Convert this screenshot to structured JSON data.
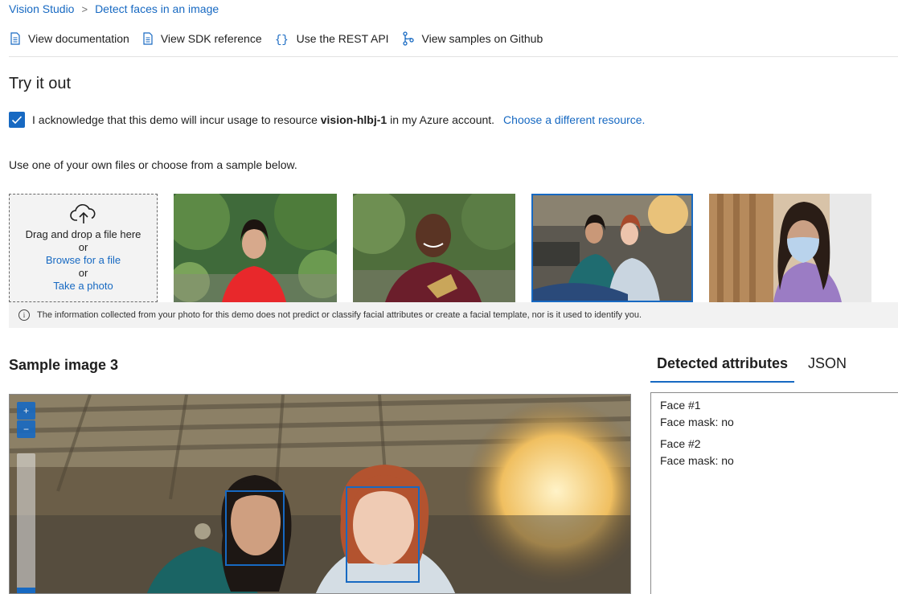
{
  "breadcrumb": {
    "root": "Vision Studio",
    "current": "Detect faces in an image"
  },
  "toolbar": {
    "docs": "View documentation",
    "sdk": "View SDK reference",
    "rest": "Use the REST API",
    "github": "View samples on Github"
  },
  "try_title": "Try it out",
  "ack": {
    "checked": true,
    "prefix": "I acknowledge that this demo will incur usage to resource",
    "resource": "vision-hlbj-1",
    "suffix": "in my Azure account.",
    "link": "Choose a different resource."
  },
  "instructions": "Use one of your own files or choose from a sample below.",
  "dropzone": {
    "drag": "Drag and drop a file here",
    "or1": "or",
    "browse": "Browse for a file",
    "or2": "or",
    "photo": "Take a photo"
  },
  "samples": {
    "selected_index": 3,
    "count": 4
  },
  "notice": "The information collected from your photo for this demo does not predict or classify facial attributes or create a facial template, nor is it used to identify you.",
  "viewer": {
    "title": "Sample image 3",
    "zoom_in": "+",
    "zoom_out": "−"
  },
  "tabs": {
    "detected": "Detected attributes",
    "json": "JSON"
  },
  "results": [
    {
      "face": "Face #1",
      "mask": "Face mask: no"
    },
    {
      "face": "Face #2",
      "mask": "Face mask: no"
    }
  ],
  "colors": {
    "accent": "#1769c2",
    "text": "#1f1f1f",
    "notice_bg": "#f2f2f2"
  }
}
